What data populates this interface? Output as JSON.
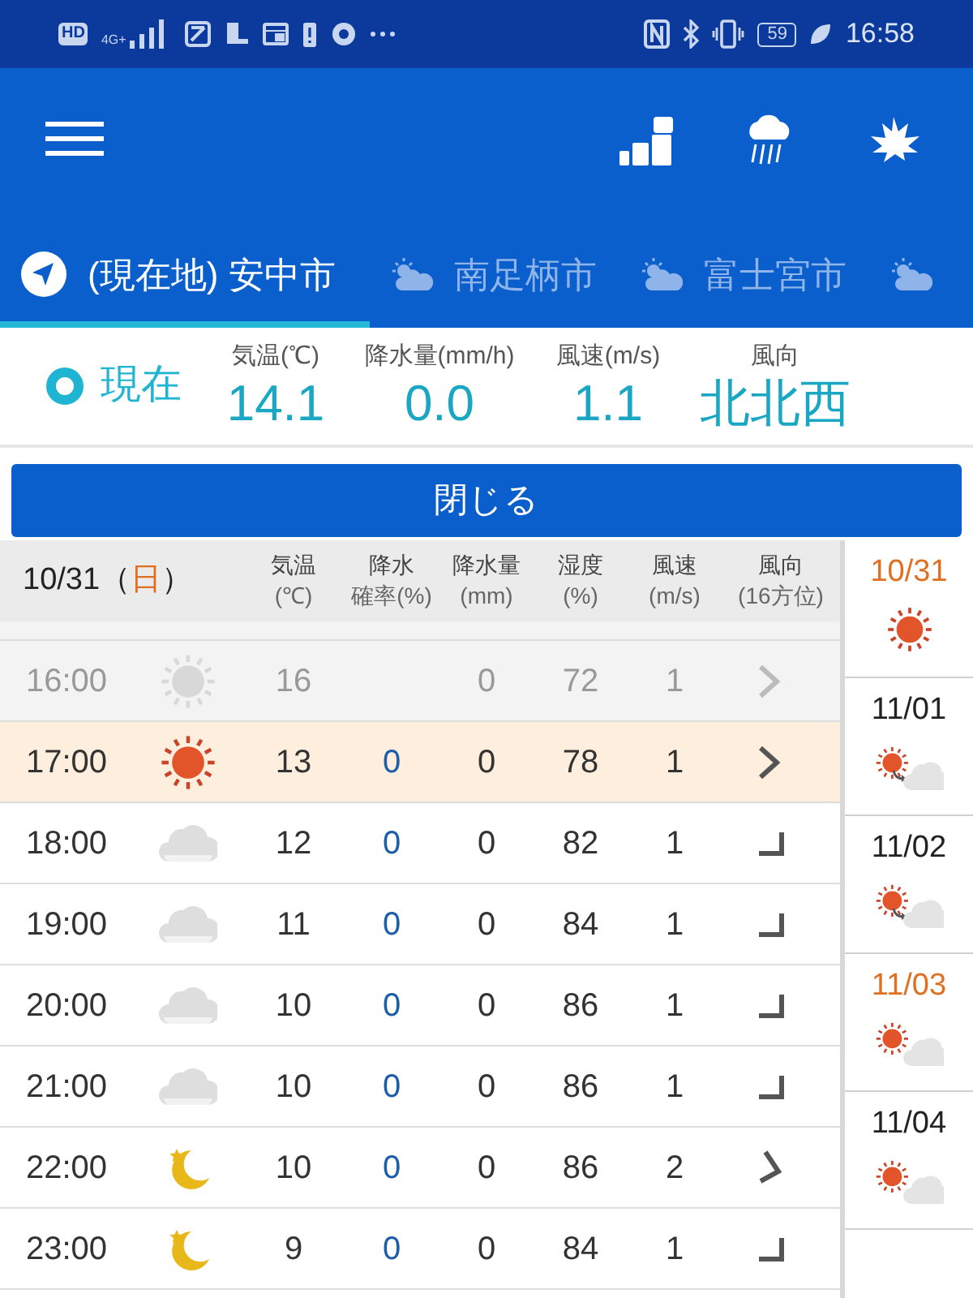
{
  "status_bar": {
    "left": [
      "HD",
      "4G+"
    ],
    "battery": "59",
    "time": "16:58"
  },
  "tabs": [
    {
      "label": "(現在地) 安中市",
      "kind": "location",
      "selected": true
    },
    {
      "label": "南足柄市",
      "kind": "weather",
      "selected": false
    },
    {
      "label": "富士宮市",
      "kind": "weather",
      "selected": false
    },
    {
      "kind": "weather",
      "selected": false
    }
  ],
  "current": {
    "label": "現在",
    "columns": [
      {
        "heading": "気温(℃)",
        "value": "14.1"
      },
      {
        "heading": "降水量(mm/h)",
        "value": "0.0"
      },
      {
        "heading": "風速(m/s)",
        "value": "1.1"
      },
      {
        "heading": "風向",
        "value": "北北西"
      }
    ]
  },
  "close_button": "閉じる",
  "table": {
    "date": "10/31（",
    "weekday": "日",
    "date_end": "）",
    "columns": [
      {
        "line1": "気温",
        "line2": "(℃)"
      },
      {
        "line1": "降水",
        "line2": "確率(%)"
      },
      {
        "line1": "降水量",
        "line2": "(mm)"
      },
      {
        "line1": "湿度",
        "line2": "(%)"
      },
      {
        "line1": "風速",
        "line2": "(m/s)"
      },
      {
        "line1": "風向",
        "line2": "(16方位)"
      }
    ],
    "rows": [
      {
        "time": "16:00",
        "kind": "past",
        "weather": {
          "kind": "sun"
        },
        "temp": "16",
        "amount": "0",
        "humidity": "72",
        "wind": "1",
        "direction": {
          "kind": "chevron"
        }
      },
      {
        "time": "17:00",
        "kind": "current",
        "weather": {
          "kind": "sun"
        },
        "temp": "13",
        "probability": "0",
        "amount": "0",
        "humidity": "78",
        "wind": "1",
        "direction": {
          "kind": "chevron"
        }
      },
      {
        "time": "18:00",
        "kind": "future",
        "weather": {
          "kind": "cloud"
        },
        "temp": "12",
        "probability": "0",
        "amount": "0",
        "humidity": "82",
        "wind": "1",
        "direction": {
          "kind": "corner"
        }
      },
      {
        "time": "19:00",
        "kind": "future",
        "weather": {
          "kind": "cloud"
        },
        "temp": "11",
        "probability": "0",
        "amount": "0",
        "humidity": "84",
        "wind": "1",
        "direction": {
          "kind": "corner"
        }
      },
      {
        "time": "20:00",
        "kind": "future",
        "weather": {
          "kind": "cloud"
        },
        "temp": "10",
        "probability": "0",
        "amount": "0",
        "humidity": "86",
        "wind": "1",
        "direction": {
          "kind": "corner"
        }
      },
      {
        "time": "21:00",
        "kind": "future",
        "weather": {
          "kind": "cloud"
        },
        "temp": "10",
        "probability": "0",
        "amount": "0",
        "humidity": "86",
        "wind": "1",
        "direction": {
          "kind": "corner"
        }
      },
      {
        "time": "22:00",
        "kind": "future",
        "weather": {
          "kind": "moon"
        },
        "temp": "10",
        "probability": "0",
        "amount": "0",
        "humidity": "86",
        "wind": "2",
        "direction": {
          "kind": "tilted"
        }
      },
      {
        "time": "23:00",
        "kind": "future",
        "weather": {
          "kind": "moon"
        },
        "temp": "9",
        "probability": "0",
        "amount": "0",
        "humidity": "84",
        "wind": "1",
        "direction": {
          "kind": "corner"
        }
      }
    ]
  },
  "days": [
    {
      "date": "10/31",
      "holiday": true,
      "weather": {
        "kind": "sun"
      }
    },
    {
      "date": "11/01",
      "holiday": false,
      "weather": {
        "kind": "sun-to-cloud"
      }
    },
    {
      "date": "11/02",
      "holiday": false,
      "weather": {
        "kind": "sun-to-cloud"
      }
    },
    {
      "date": "11/03",
      "holiday": true,
      "weather": {
        "kind": "sun-cloud"
      }
    },
    {
      "date": "11/04",
      "holiday": false,
      "weather": {
        "kind": "sun-cloud"
      }
    }
  ]
}
